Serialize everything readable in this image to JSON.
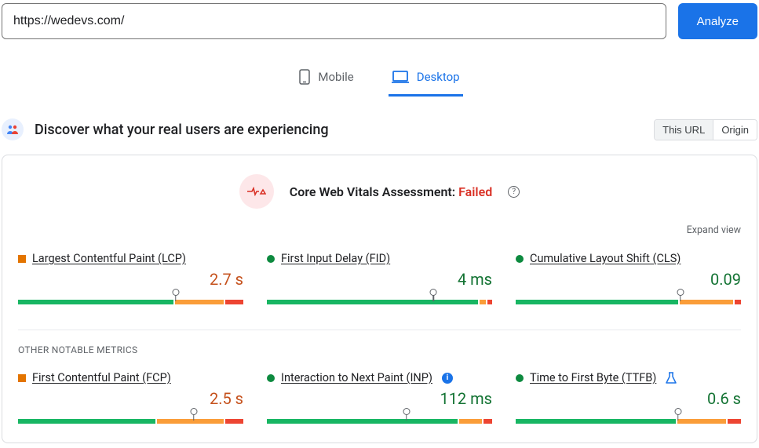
{
  "url_input": {
    "value": "https://wedevs.com/"
  },
  "analyze_button": "Analyze",
  "tabs": {
    "mobile": "Mobile",
    "desktop": "Desktop",
    "active": "desktop"
  },
  "discover": {
    "title": "Discover what your real users are experiencing"
  },
  "scope_toggle": {
    "this_url": "This URL",
    "origin": "Origin",
    "active": "this_url"
  },
  "assessment": {
    "label": "Core Web Vitals Assessment:",
    "status": "Failed"
  },
  "expand_link": "Expand view",
  "section_other": "OTHER NOTABLE METRICS",
  "colors": {
    "green": "#18b663",
    "orange": "#fa9d39",
    "red": "#ed4532",
    "text_orange": "#c5511c",
    "text_green": "#137333"
  },
  "metrics_core": [
    {
      "name": "Largest Contentful Paint (LCP)",
      "value": "2.7 s",
      "status": "orange",
      "segments": [
        70,
        22,
        8
      ],
      "marker": 70
    },
    {
      "name": "First Input Delay (FID)",
      "value": "4 ms",
      "status": "green",
      "segments": [
        95,
        3,
        2
      ],
      "marker": 74
    },
    {
      "name": "Cumulative Layout Shift (CLS)",
      "value": "0.09",
      "status": "green",
      "segments": [
        73,
        24,
        3
      ],
      "marker": 73
    }
  ],
  "metrics_other": [
    {
      "name": "First Contentful Paint (FCP)",
      "value": "2.5 s",
      "status": "orange",
      "segments": [
        62,
        30,
        8
      ],
      "marker": 78,
      "badge": null
    },
    {
      "name": "Interaction to Next Paint (INP)",
      "value": "112 ms",
      "status": "green",
      "segments": [
        86,
        10,
        4
      ],
      "marker": 62,
      "badge": "info"
    },
    {
      "name": "Time to First Byte (TTFB)",
      "value": "0.6 s",
      "status": "green",
      "segments": [
        72,
        22,
        6
      ],
      "marker": 72,
      "badge": "flask"
    }
  ]
}
